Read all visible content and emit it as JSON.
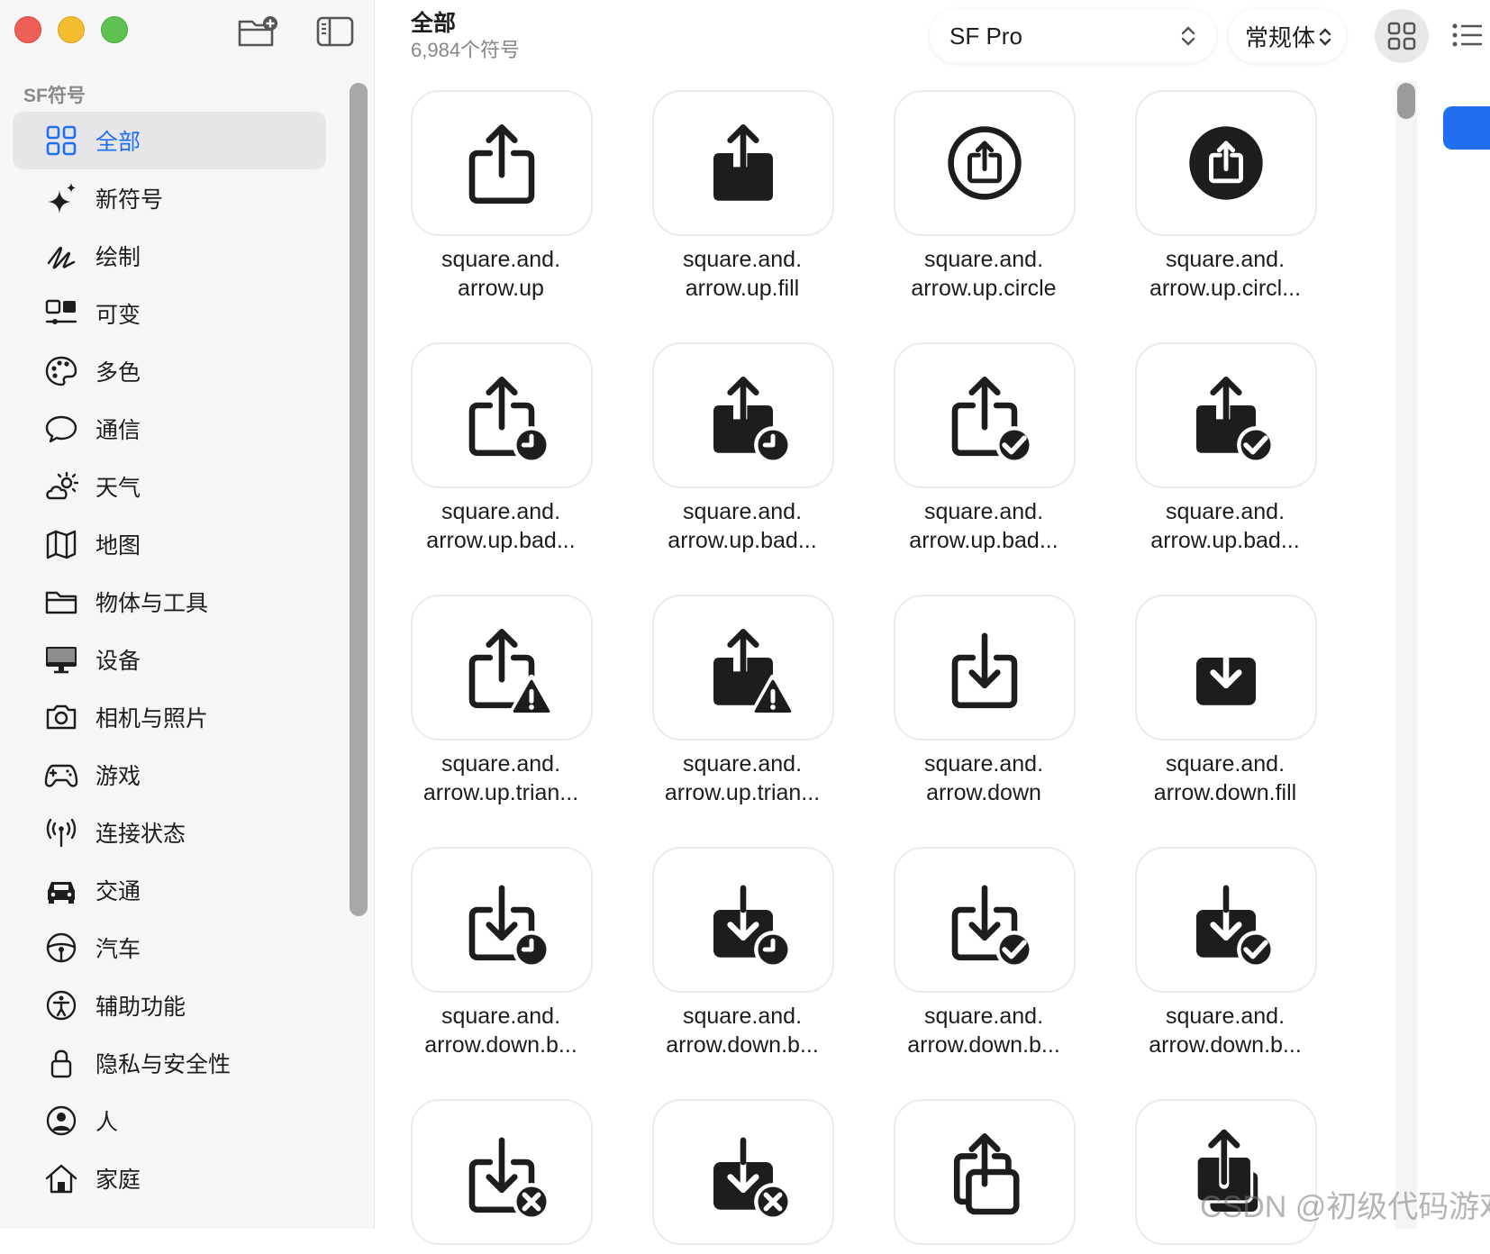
{
  "window": {
    "title": "全部",
    "subtitle": "6,984个符号"
  },
  "toolbar": {
    "font_select": "SF Pro",
    "weight_select": "常规体",
    "grid_view_icon": "grid-icon",
    "list_view_icon": "list-icon",
    "new_folder_icon": "folder-badge-plus-icon",
    "sidebar_toggle_icon": "sidebar-icon"
  },
  "colors": {
    "accent": "#1f6ff0",
    "close": "#ee5f57",
    "minimize": "#f3bd2f",
    "zoom": "#5fc152"
  },
  "sidebar": {
    "heading": "SF符号",
    "items": [
      {
        "label": "全部",
        "icon": "grid-icon",
        "active": true
      },
      {
        "label": "新符号",
        "icon": "sparkles-icon"
      },
      {
        "label": "绘制",
        "icon": "scribble-icon"
      },
      {
        "label": "可变",
        "icon": "variable-icon"
      },
      {
        "label": "多色",
        "icon": "paintpalette-icon"
      },
      {
        "label": "通信",
        "icon": "message-icon"
      },
      {
        "label": "天气",
        "icon": "cloud-sun-icon"
      },
      {
        "label": "地图",
        "icon": "map-icon"
      },
      {
        "label": "物体与工具",
        "icon": "folder-icon"
      },
      {
        "label": "设备",
        "icon": "display-icon"
      },
      {
        "label": "相机与照片",
        "icon": "camera-icon"
      },
      {
        "label": "游戏",
        "icon": "gamecontroller-icon"
      },
      {
        "label": "连接状态",
        "icon": "antenna-icon"
      },
      {
        "label": "交通",
        "icon": "car-icon"
      },
      {
        "label": "汽车",
        "icon": "steeringwheel-icon"
      },
      {
        "label": "辅助功能",
        "icon": "accessibility-icon"
      },
      {
        "label": "隐私与安全性",
        "icon": "lock-icon"
      },
      {
        "label": "人",
        "icon": "person-circle-icon"
      },
      {
        "label": "家庭",
        "icon": "house-icon"
      }
    ]
  },
  "symbols": [
    {
      "line1": "square.and.",
      "line2": "arrow.up",
      "icon": "square-arrow-up-icon"
    },
    {
      "line1": "square.and.",
      "line2": "arrow.up.fill",
      "icon": "square-arrow-up-fill-icon"
    },
    {
      "line1": "square.and.",
      "line2": "arrow.up.circle",
      "icon": "square-arrow-up-circle-icon"
    },
    {
      "line1": "square.and.",
      "line2": "arrow.up.circl...",
      "icon": "square-arrow-up-circle-fill-icon"
    },
    {
      "line1": "square.and.",
      "line2": "arrow.up.bad...",
      "icon": "square-arrow-up-badge-clock-icon"
    },
    {
      "line1": "square.and.",
      "line2": "arrow.up.bad...",
      "icon": "square-arrow-up-fill-badge-clock-icon"
    },
    {
      "line1": "square.and.",
      "line2": "arrow.up.bad...",
      "icon": "square-arrow-up-badge-checkmark-icon"
    },
    {
      "line1": "square.and.",
      "line2": "arrow.up.bad...",
      "icon": "square-arrow-up-fill-badge-checkmark-icon"
    },
    {
      "line1": "square.and.",
      "line2": "arrow.up.trian...",
      "icon": "square-arrow-up-trianglebadge-icon"
    },
    {
      "line1": "square.and.",
      "line2": "arrow.up.trian...",
      "icon": "square-arrow-up-fill-trianglebadge-icon"
    },
    {
      "line1": "square.and.",
      "line2": "arrow.down",
      "icon": "square-arrow-down-icon"
    },
    {
      "line1": "square.and.",
      "line2": "arrow.down.fill",
      "icon": "square-arrow-down-fill-icon"
    },
    {
      "line1": "square.and.",
      "line2": "arrow.down.b...",
      "icon": "square-arrow-down-badge-clock-icon"
    },
    {
      "line1": "square.and.",
      "line2": "arrow.down.b...",
      "icon": "square-arrow-down-fill-badge-clock-icon"
    },
    {
      "line1": "square.and.",
      "line2": "arrow.down.b...",
      "icon": "square-arrow-down-badge-checkmark-icon"
    },
    {
      "line1": "square.and.",
      "line2": "arrow.down.b...",
      "icon": "square-arrow-down-fill-badge-checkmark-icon"
    },
    {
      "line1": "",
      "line2": "",
      "icon": "square-arrow-down-badge-xmark-icon"
    },
    {
      "line1": "",
      "line2": "",
      "icon": "square-arrow-down-fill-badge-xmark-icon"
    },
    {
      "line1": "",
      "line2": "",
      "icon": "square-on-square-arrow-up-icon"
    },
    {
      "line1": "",
      "line2": "",
      "icon": "square-on-square-arrow-up-fill-icon"
    }
  ],
  "watermark": "CSDN @初级代码游戏"
}
